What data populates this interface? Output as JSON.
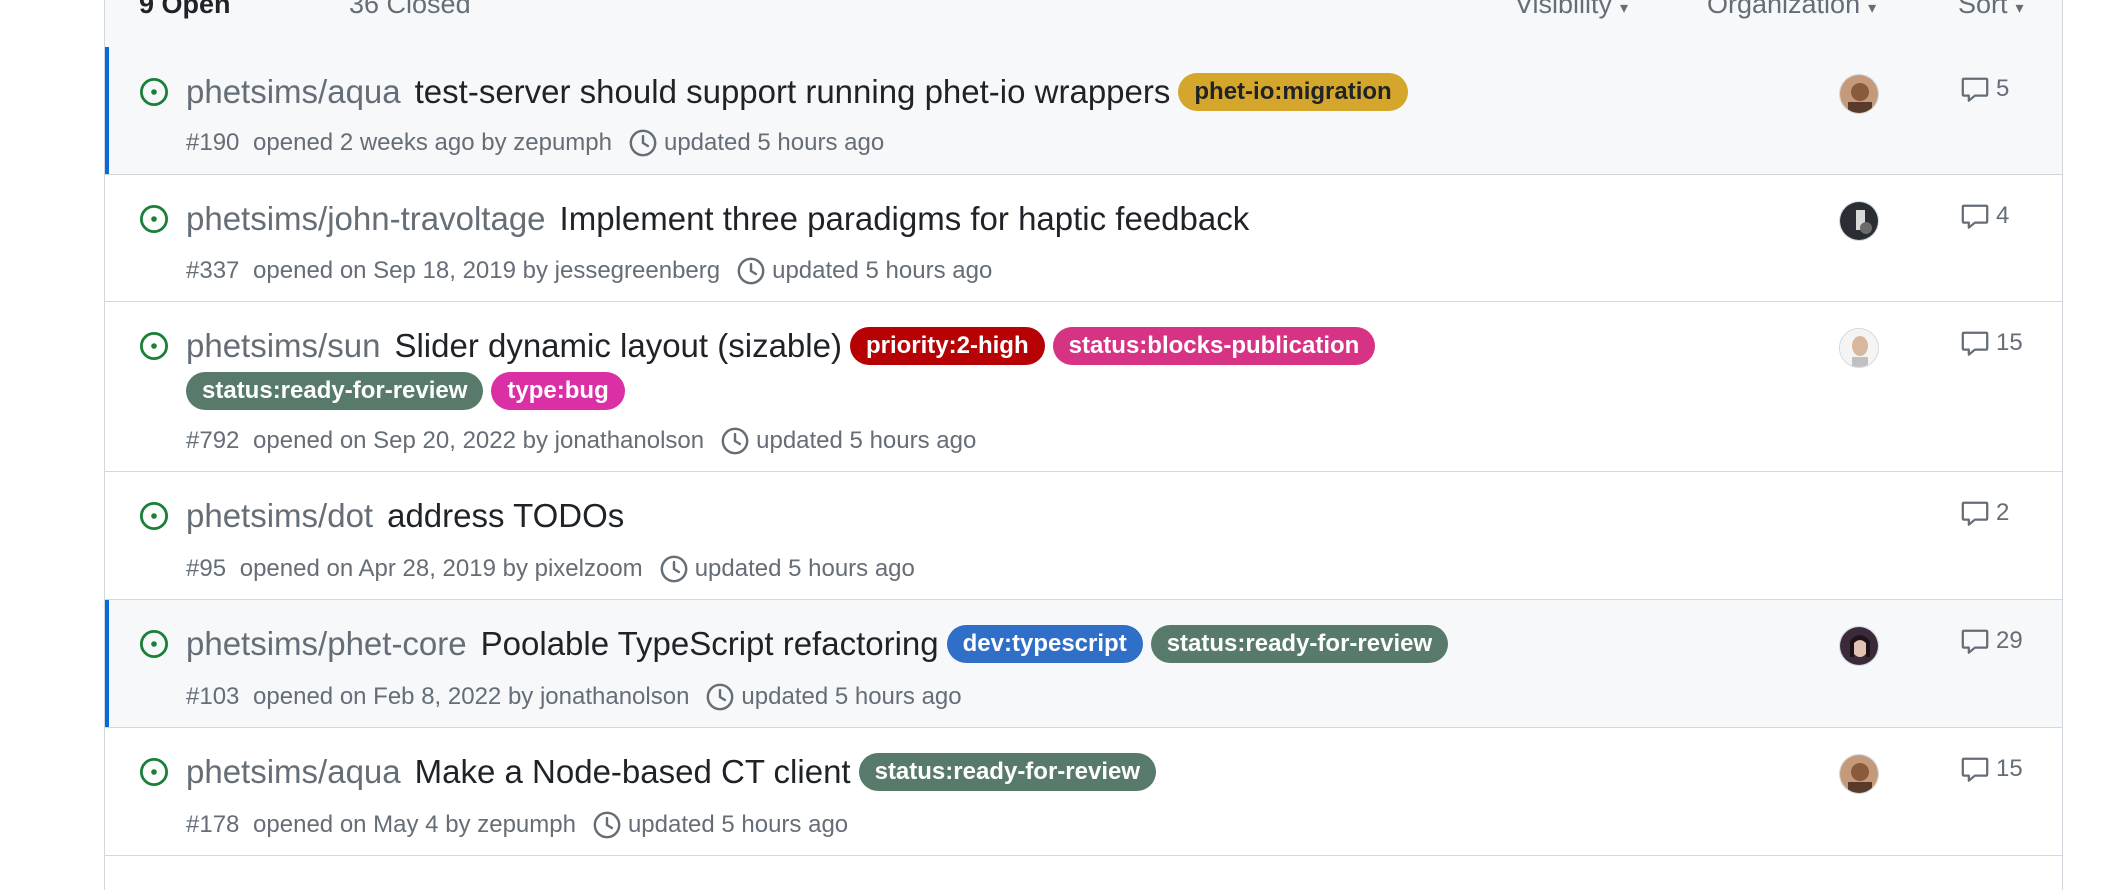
{
  "header": {
    "open_label": "9 Open",
    "closed_label": "36 Closed",
    "filters": [
      "Visibility",
      "Organization",
      "Sort"
    ]
  },
  "colors": {
    "open_icon": "#1a7f37",
    "unread_bar": "#0969da",
    "phet_io_migration": "#d4a72c",
    "priority_high": "#b60205",
    "status_blocks_publication": "#d63384",
    "status_ready_for_review": "#587a6b",
    "type_bug": "#db2fa6",
    "dev_typescript": "#2f6fc7"
  },
  "issues": [
    {
      "repo": "phetsims/aqua",
      "title": "test-server should support running phet-io wrappers",
      "labels": [
        {
          "text": "phet-io:migration",
          "bg": "#d4a72c",
          "fg": "#1f2328"
        }
      ],
      "number": "#190",
      "opened": "opened 2 weeks ago by zepumph",
      "updated": "updated 5 hours ago",
      "comments": "5",
      "avatar": "avatar-zepumph",
      "unread": true
    },
    {
      "repo": "phetsims/john-travoltage",
      "title": "Implement three paradigms for haptic feedback",
      "labels": [],
      "number": "#337",
      "opened": "opened on Sep 18, 2019 by jessegreenberg",
      "updated": "updated 5 hours ago",
      "comments": "4",
      "avatar": "avatar-jessegreenberg",
      "unread": false
    },
    {
      "repo": "phetsims/sun",
      "title": "Slider dynamic layout (sizable)",
      "labels": [
        {
          "text": "priority:2-high",
          "bg": "#b60205",
          "fg": "#ffffff"
        },
        {
          "text": "status:blocks-publication",
          "bg": "#d63384",
          "fg": "#ffffff"
        },
        {
          "text": "status:ready-for-review",
          "bg": "#587a6b",
          "fg": "#ffffff"
        },
        {
          "text": "type:bug",
          "bg": "#db2fa6",
          "fg": "#ffffff"
        }
      ],
      "number": "#792",
      "opened": "opened on Sep 20, 2022 by jonathanolson",
      "updated": "updated 5 hours ago",
      "comments": "15",
      "avatar": "avatar-jonathanolson",
      "unread": false
    },
    {
      "repo": "phetsims/dot",
      "title": "address TODOs",
      "labels": [],
      "number": "#95",
      "opened": "opened on Apr 28, 2019 by pixelzoom",
      "updated": "updated 5 hours ago",
      "comments": "2",
      "avatar": "",
      "unread": false
    },
    {
      "repo": "phetsims/phet-core",
      "title": "Poolable TypeScript refactoring",
      "labels": [
        {
          "text": "dev:typescript",
          "bg": "#2f6fc7",
          "fg": "#ffffff"
        },
        {
          "text": "status:ready-for-review",
          "bg": "#587a6b",
          "fg": "#ffffff"
        }
      ],
      "number": "#103",
      "opened": "opened on Feb 8, 2022 by jonathanolson",
      "updated": "updated 5 hours ago",
      "comments": "29",
      "avatar": "avatar-user",
      "unread": true
    },
    {
      "repo": "phetsims/aqua",
      "title": "Make a Node-based CT client",
      "labels": [
        {
          "text": "status:ready-for-review",
          "bg": "#587a6b",
          "fg": "#ffffff"
        }
      ],
      "number": "#178",
      "opened": "opened on May 4 by zepumph",
      "updated": "updated 5 hours ago",
      "comments": "15",
      "avatar": "avatar-zepumph",
      "unread": false
    }
  ]
}
